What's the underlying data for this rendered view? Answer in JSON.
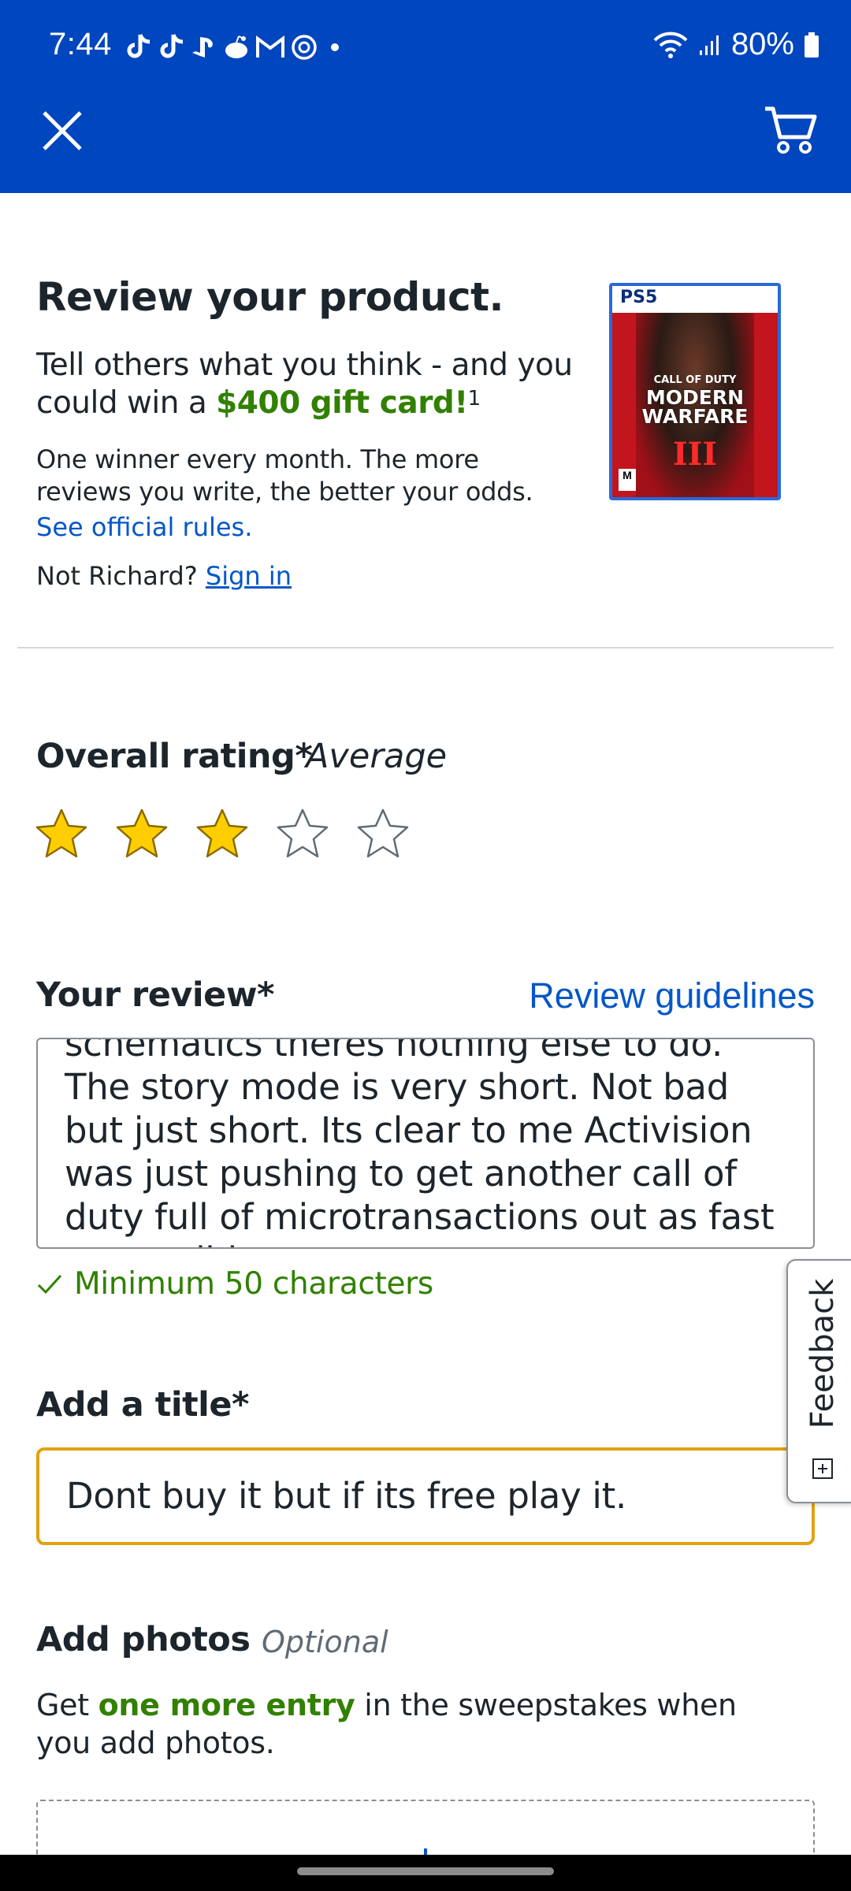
{
  "status_bar": {
    "time": "7:44",
    "battery_percent": "80%",
    "notification_icons": [
      "tiktok-icon",
      "tiktok-icon",
      "playstation-icon",
      "reddit-icon",
      "gmail-icon",
      "sync-icon",
      "dot-icon"
    ],
    "right_icons": [
      "wifi-icon",
      "signal-icon",
      "battery-icon"
    ]
  },
  "header": {
    "background": "#0046be",
    "close_icon": "close-icon",
    "cart_icon": "cart-icon"
  },
  "hero": {
    "title": "Review your product.",
    "tagline_pre": "Tell others what you think - and you could win a ",
    "tagline_highlight": "$400 gift card!",
    "tagline_sup": "1",
    "winner_text": "One winner every month. The more reviews you write, the better your odds.",
    "rules_link": "See official rules.",
    "not_user_text": "Not Richard? ",
    "sign_in_link": "Sign in",
    "product_image": {
      "platform": "PS5",
      "brand": "CALL OF DUTY",
      "game_title_line1": "MODERN",
      "game_title_line2": "WARFARE",
      "game_numeral": "III",
      "rating_mark": "M"
    }
  },
  "rating": {
    "label": "Overall rating*",
    "value_word": "Average",
    "stars_filled": 3,
    "stars_total": 5,
    "star_color": "#ffce00"
  },
  "review": {
    "label": "Your review*",
    "guidelines_link": "Review guidelines",
    "text": "schematics theres nothing else to do. The story mode is very short. Not bad but just short. Its clear to me Activision was just pushing to get another call of duty full of microtransactions out as fast as possible.",
    "min_chars_text": "Minimum 50 characters"
  },
  "title_field": {
    "label": "Add a title*",
    "value": "Dont buy it but if its free play it."
  },
  "feedback_tab": {
    "label": "Feedback"
  },
  "photos": {
    "label": "Add photos",
    "optional": "Optional",
    "desc_pre": "Get ",
    "desc_highlight": "one more entry",
    "desc_post": " in the sweepstakes when you add photos."
  },
  "colors": {
    "brand_blue": "#0046be",
    "link_blue": "#0457c8",
    "success_green": "#318000",
    "focus_yellow": "#e2a211"
  }
}
